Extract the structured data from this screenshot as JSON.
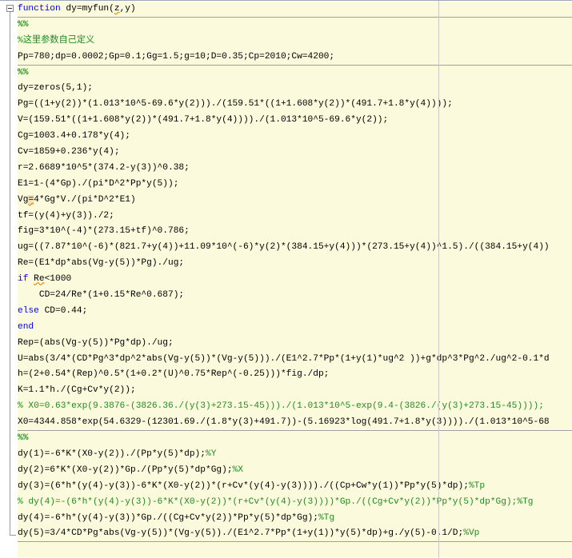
{
  "editor": {
    "lines": [
      {
        "div": true,
        "segments": [
          {
            "text": "function",
            "style": "kw"
          },
          {
            "text": " dy=myfun(",
            "style": "code"
          },
          {
            "text": "z",
            "style": "warn-u"
          },
          {
            "text": ",y)",
            "style": "code"
          }
        ]
      },
      {
        "segments": [
          {
            "text": "%%",
            "style": "section"
          }
        ]
      },
      {
        "segments": [
          {
            "text": "%这里参数自己定义",
            "style": "comment"
          }
        ]
      },
      {
        "div": true,
        "segments": [
          {
            "text": "Pp=780;dp=0.0002;Gp=0.1;Gg=1.5;g=10;D=0.35;Cp=2010;Cw=4200;",
            "style": "code"
          }
        ]
      },
      {
        "segments": [
          {
            "text": "%%",
            "style": "section"
          }
        ]
      },
      {
        "segments": [
          {
            "text": "dy=zeros(5,1);",
            "style": "code"
          }
        ]
      },
      {
        "segments": [
          {
            "text": "Pg=((1+y(2))*(1.013*10^5-69.6*y(2)))./(159.51*((1+1.608*y(2))*(491.7+1.8*y(4))));",
            "style": "code"
          }
        ]
      },
      {
        "segments": [
          {
            "text": "V=(159.51*((1+1.608*y(2))*(491.7+1.8*y(4))))./(1.013*10^5-69.6*y(2));",
            "style": "code"
          }
        ]
      },
      {
        "segments": [
          {
            "text": "Cg=1003.4+0.178*y(4);",
            "style": "code"
          }
        ]
      },
      {
        "segments": [
          {
            "text": "Cv=1859+0.236*y(4);",
            "style": "code"
          }
        ]
      },
      {
        "segments": [
          {
            "text": "r=2.6689*10^5*(374.2-y(3))^0.38;",
            "style": "code"
          }
        ]
      },
      {
        "segments": [
          {
            "text": "E1=1-(4*Gp)./(pi*D^2*Pp*y(5));",
            "style": "code"
          }
        ]
      },
      {
        "segments": [
          {
            "text": "Vg",
            "style": "code"
          },
          {
            "text": "=",
            "style": "warn"
          },
          {
            "text": "4*Gg*V./(pi*D^2*E1)",
            "style": "code"
          }
        ]
      },
      {
        "segments": [
          {
            "text": "tf=(y(4)+y(3))./2;",
            "style": "code"
          }
        ]
      },
      {
        "segments": [
          {
            "text": "fig=3*10^(-4)*(273.15+tf)^0.786;",
            "style": "code"
          }
        ]
      },
      {
        "segments": [
          {
            "text": "ug=((7.87*10^(-6)*(821.7+y(4))+11.09*10^(-6)*y(2)*(384.15+y(4)))*(273.15+y(4))^1.5)./((384.15+y(4))",
            "style": "code"
          }
        ]
      },
      {
        "segments": [
          {
            "text": "Re=(E1*dp*abs(Vg-y(5))*Pg)./ug;",
            "style": "code"
          }
        ]
      },
      {
        "segments": [
          {
            "text": "if",
            "style": "kw"
          },
          {
            "text": " ",
            "style": "code"
          },
          {
            "text": "Re",
            "style": "warn-u"
          },
          {
            "text": "<1000",
            "style": "code"
          }
        ]
      },
      {
        "segments": [
          {
            "text": "    CD=24/Re*(1+0.15*Re^0.687);",
            "style": "code"
          }
        ]
      },
      {
        "segments": [
          {
            "text": "else",
            "style": "kw"
          },
          {
            "text": " CD=0.44;",
            "style": "code"
          }
        ]
      },
      {
        "segments": [
          {
            "text": "end",
            "style": "kw"
          }
        ]
      },
      {
        "segments": [
          {
            "text": "Rep=(abs(Vg-y(5))*Pg*dp)./ug;",
            "style": "code"
          }
        ]
      },
      {
        "segments": [
          {
            "text": "U=abs(3/4*(CD*Pg^3*dp^2*abs(Vg-y(5))*(Vg-y(5)))./(E1^2.7*Pp*(1+y(1)*ug^2 ))+g*dp^3*Pg^2./ug^2-0.1*d",
            "style": "code"
          }
        ]
      },
      {
        "segments": [
          {
            "text": "h=(2+0.54*(Rep)^0.5*(1+0.2*(U)^0.75*Rep^(-0.25)))*fig./dp;",
            "style": "code"
          }
        ]
      },
      {
        "segments": [
          {
            "text": "K=1.1*h./(Cg+Cv*y(2));",
            "style": "code"
          }
        ]
      },
      {
        "segments": [
          {
            "text": "% X0=0.63*exp(9.3876-(3826.36./(y(3)+273.15-45)))./(1.013*10^5-exp(9.4-(3826./(y(3)+273.15-45))));",
            "style": "comment"
          }
        ]
      },
      {
        "div": true,
        "segments": [
          {
            "text": "X0=4344.858*exp(54.6329-(12301.69./(1.8*y(3)+491.7))-(5.16923*log(491.7+1.8*y(3))))./(1.013*10^5-68",
            "style": "code"
          }
        ]
      },
      {
        "segments": [
          {
            "text": "%%",
            "style": "section"
          }
        ]
      },
      {
        "segments": [
          {
            "text": "dy(1)=-6*K*(X0-y(2))./(Pp*y(5)*dp);",
            "style": "code"
          },
          {
            "text": "%Y",
            "style": "comment"
          }
        ]
      },
      {
        "segments": [
          {
            "text": "dy(2)=6*K*(X0-y(2))*Gp./(Pp*y(5)*dp*Gg);",
            "style": "code"
          },
          {
            "text": "%X",
            "style": "comment"
          }
        ]
      },
      {
        "segments": [
          {
            "text": "dy(3)=(6*h*(y(4)-y(3))-6*K*(X0-y(2))*(r+Cv*(y(4)-y(3))))./((Cp+Cw*y(1))*Pp*y(5)*dp);",
            "style": "code"
          },
          {
            "text": "%Tp",
            "style": "comment"
          }
        ]
      },
      {
        "segments": [
          {
            "text": "% dy(4)=-(6*h*(y(4)-y(3))-6*K*(X0-y(2))*(r+Cv*(y(4)-y(3))))*Gp./((Cg+Cv*y(2))*Pp*y(5)*dp*Gg);%Tg",
            "style": "comment"
          }
        ]
      },
      {
        "segments": [
          {
            "text": "dy(4)=-6*h*(y(4)-y(3))*Gp./((Cg+Cv*y(2))*Pp*y(5)*dp*Gg);",
            "style": "code"
          },
          {
            "text": "%Tg",
            "style": "comment"
          }
        ]
      },
      {
        "div": true,
        "segments": [
          {
            "text": "dy(5)=3/4*CD*Pg*abs(Vg-y(5))*(Vg-y(5))./(E1^2.7*Pp*(1+y(1))*y(5)*dp)+g./y(5)-0.1/D;",
            "style": "code"
          },
          {
            "text": "%Vp",
            "style": "comment"
          }
        ]
      }
    ]
  },
  "colors": {
    "keyword": "#0000ff",
    "comment": "#228b22",
    "cell_background": "#fbfadc"
  }
}
